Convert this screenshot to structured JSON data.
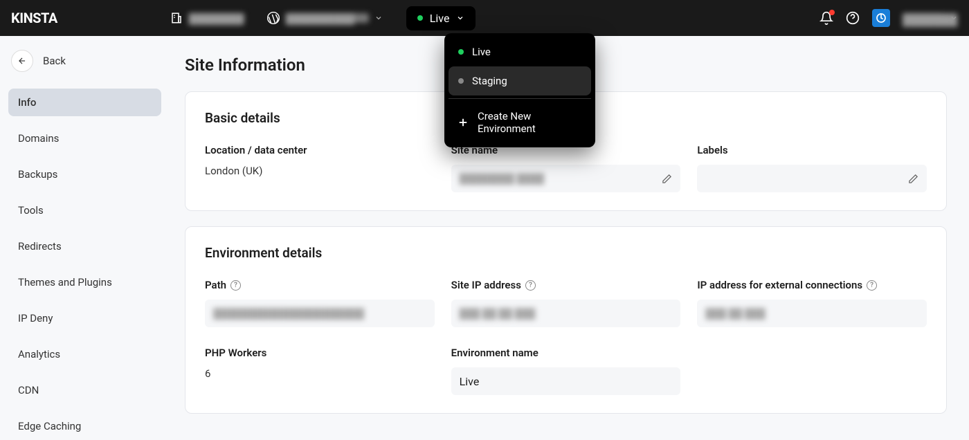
{
  "header": {
    "logo": "KINSTA",
    "company_placeholder": "████████",
    "site_placeholder": "██████████",
    "env_selected": "Live",
    "user_placeholder": "███████"
  },
  "env_dropdown": {
    "options": [
      {
        "label": "Live",
        "dot": "green"
      },
      {
        "label": "Staging",
        "dot": "gray"
      }
    ],
    "create_label": "Create New Environment"
  },
  "sidebar": {
    "back_label": "Back",
    "items": [
      "Info",
      "Domains",
      "Backups",
      "Tools",
      "Redirects",
      "Themes and Plugins",
      "IP Deny",
      "Analytics",
      "CDN",
      "Edge Caching"
    ]
  },
  "page": {
    "title": "Site Information"
  },
  "basic": {
    "title": "Basic details",
    "location_label": "Location / data center",
    "location_value": "London (UK)",
    "sitename_label": "Site name",
    "sitename_value": "████████ ████",
    "labels_label": "Labels"
  },
  "env": {
    "title": "Environment details",
    "path_label": "Path",
    "path_value": "██████████████████████",
    "siteip_label": "Site IP address",
    "siteip_value": "███ ██ ██ ███",
    "extip_label": "IP address for external connections",
    "extip_value": "███ ██ ███",
    "php_label": "PHP Workers",
    "php_value": "6",
    "envname_label": "Environment name",
    "envname_value": "Live"
  }
}
